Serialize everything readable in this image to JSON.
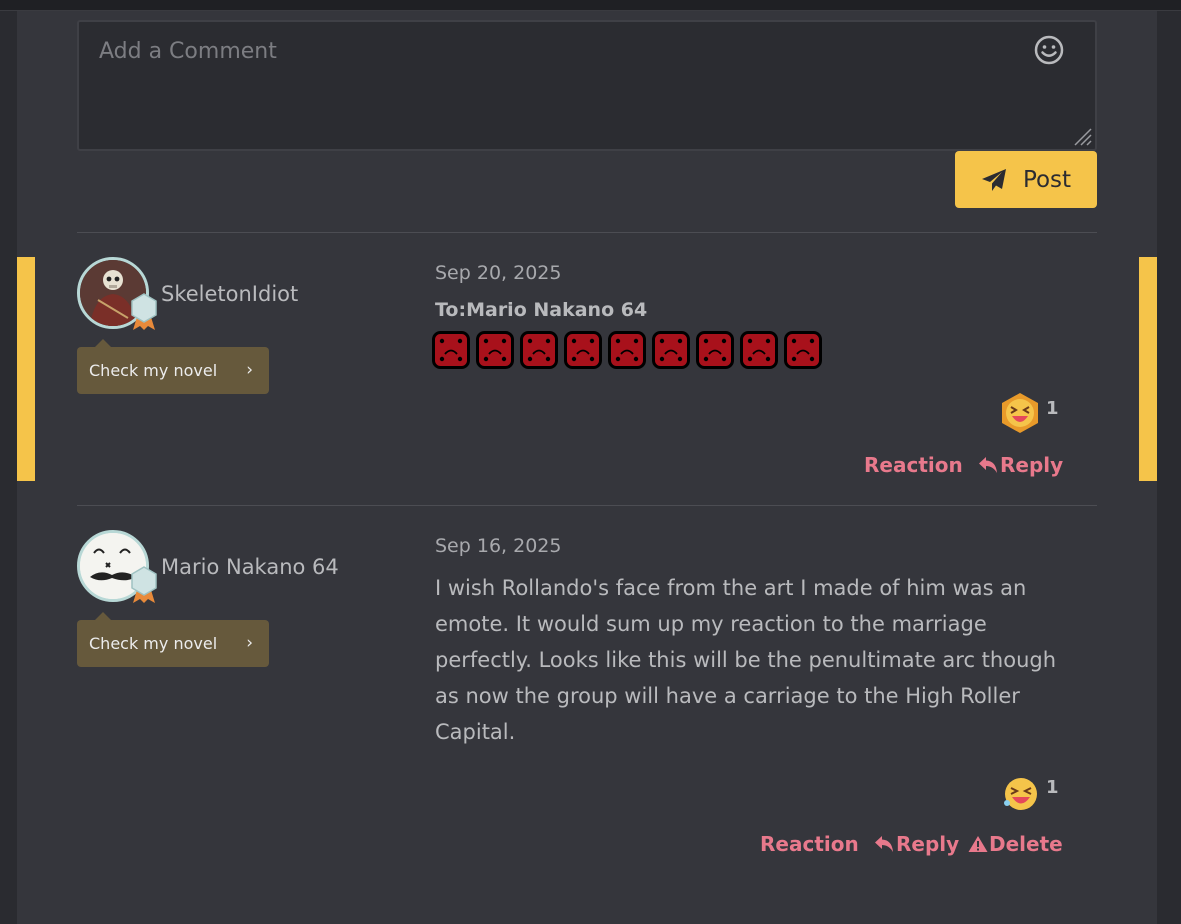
{
  "comment_box": {
    "placeholder": "Add a Comment",
    "post_label": "Post"
  },
  "comments": [
    {
      "username": "SkeletonIdiot",
      "novel_label": "Check my novel",
      "date": "Sep 20, 2025",
      "to_line": "To:Mario Nakano 64",
      "emote_count": 9,
      "reaction_count": "1",
      "actions": {
        "reaction": "Reaction",
        "reply": "Reply"
      }
    },
    {
      "username": "Mario Nakano 64",
      "novel_label": "Check my novel",
      "date": "Sep 16, 2025",
      "body": "I wish Rollando's face from the art I made of him was an emote. It would sum up my reaction to the marriage perfectly. Looks like this will be the penultimate arc though as now the group will have a carriage to the High Roller Capital.",
      "reaction_count": "1",
      "actions": {
        "reaction": "Reaction",
        "reply": "Reply",
        "delete": "Delete"
      }
    }
  ],
  "colors": {
    "accent": "#f5c44a",
    "action": "#e8798c",
    "panel": "#35363c"
  }
}
